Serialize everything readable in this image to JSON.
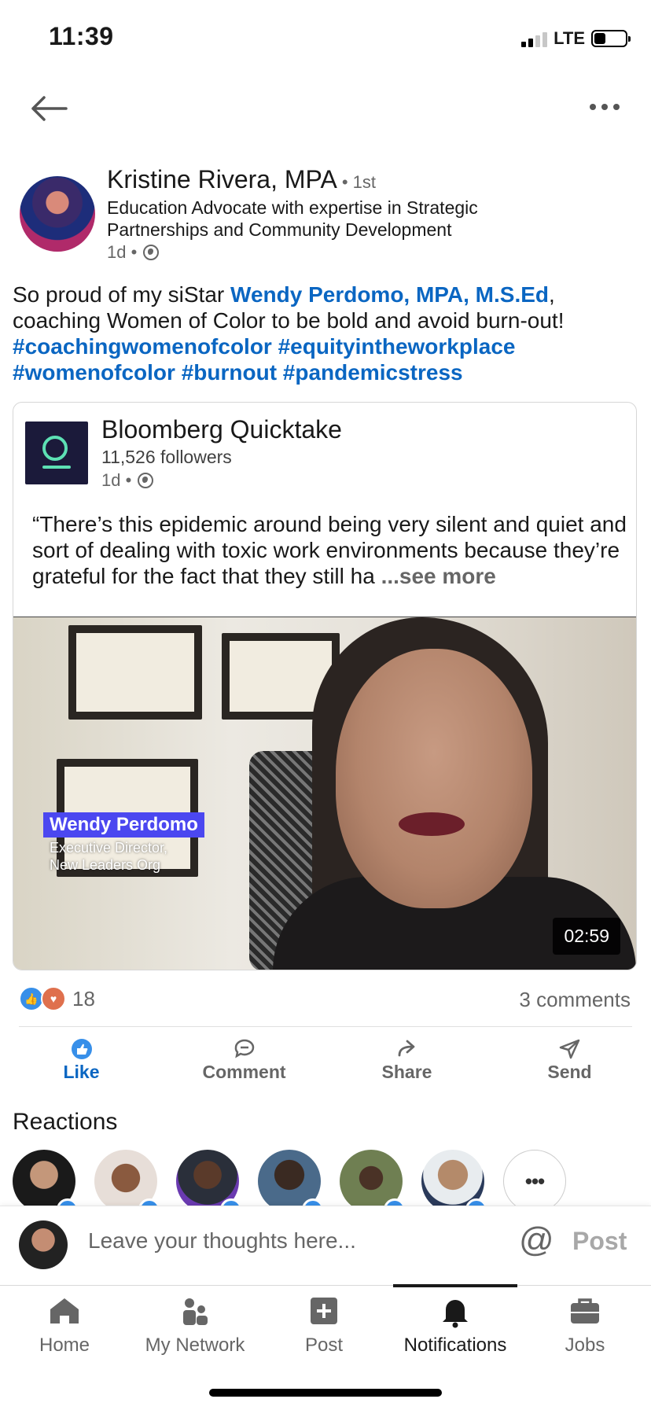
{
  "status_bar": {
    "time": "11:39",
    "network": "LTE"
  },
  "post": {
    "author": {
      "name": "Kristine Rivera, MPA",
      "degree": "• 1st",
      "headline": "Education Advocate with expertise in Strategic Partnerships and Community Development",
      "time": "1d •"
    },
    "text": {
      "intro": "So proud of my siStar ",
      "mention": "Wendy Perdomo, MPA, M.S.Ed",
      "after_mention": ", coaching Women of Color to be bold and avoid burn-out!",
      "hashtags": [
        "#coachingwomenofcolor",
        "#equityintheworkplace",
        "#womenofcolor",
        "#burnout",
        "#pandemicstress"
      ]
    },
    "shared": {
      "source_name": "Bloomberg Quicktake",
      "followers": "11,526 followers",
      "time": "1d •",
      "quote": "“There’s this epidemic around being very silent and quiet and sort of dealing with toxic work environments because they’re grateful for the fact that they still ha",
      "see_more": "...see more",
      "video": {
        "lower_third_name": "Wendy Perdomo",
        "lower_third_title_1": "Executive Director,",
        "lower_third_title_2": "New Leaders Org",
        "duration": "02:59"
      }
    },
    "social": {
      "reaction_count": "18",
      "comments": "3 comments"
    },
    "actions": {
      "like": "Like",
      "comment": "Comment",
      "share": "Share",
      "send": "Send"
    },
    "reactions_title": "Reactions",
    "reactors_more": "•••"
  },
  "comment_box": {
    "placeholder": "Leave your thoughts here...",
    "at": "@",
    "post_label": "Post"
  },
  "nav": {
    "home": "Home",
    "network": "My Network",
    "post": "Post",
    "notifications": "Notifications",
    "jobs": "Jobs"
  },
  "colors": {
    "accent": "#0a66c2",
    "like": "#378fe9",
    "love": "#df704d",
    "lower_third": "#4b47f0"
  }
}
